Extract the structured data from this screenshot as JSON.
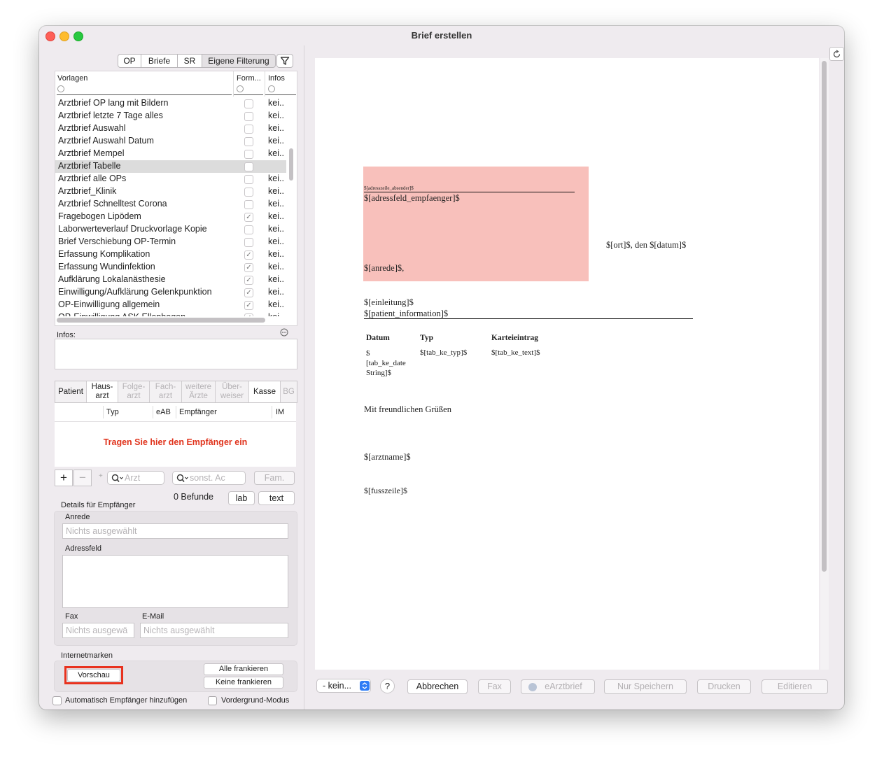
{
  "window": {
    "title": "Brief erstellen"
  },
  "filter_tabs": [
    "OP",
    "Briefe",
    "SR",
    "Eigene Filterung"
  ],
  "list": {
    "headers": {
      "vorlagen": "Vorlagen",
      "form": "Form...",
      "infos": "Infos"
    },
    "rows": [
      {
        "name": "Arztbrief OP lang mit Bildern",
        "checked": false,
        "info": "kei.."
      },
      {
        "name": "Arztbrief letzte 7 Tage alles",
        "checked": false,
        "info": "kei.."
      },
      {
        "name": "Arztbrief Auswahl",
        "checked": false,
        "info": "kei.."
      },
      {
        "name": "Arztbrief Auswahl Datum",
        "checked": false,
        "info": "kei.."
      },
      {
        "name": "Arztbrief Mempel",
        "checked": false,
        "info": "kei.."
      },
      {
        "name": "Arztbrief Tabelle",
        "checked": false,
        "info": "",
        "selected": true
      },
      {
        "name": "Arztbrief alle OPs",
        "checked": false,
        "info": "kei.."
      },
      {
        "name": "Arztbrief_Klinik",
        "checked": false,
        "info": "kei.."
      },
      {
        "name": "Arztbrief Schnelltest Corona",
        "checked": false,
        "info": "kei.."
      },
      {
        "name": "Fragebogen Lipödem",
        "checked": true,
        "info": "kei.."
      },
      {
        "name": "Laborwerteverlauf Druckvorlage Kopie",
        "checked": false,
        "info": "kei.."
      },
      {
        "name": "Brief Verschiebung OP-Termin",
        "checked": false,
        "info": "kei.."
      },
      {
        "name": "Erfassung Komplikation",
        "checked": true,
        "info": "kei.."
      },
      {
        "name": "Erfassung Wundinfektion",
        "checked": true,
        "info": "kei.."
      },
      {
        "name": "Aufklärung Lokalanästhesie",
        "checked": true,
        "info": "kei.."
      },
      {
        "name": "Einwilligung/Aufklärung Gelenkpunktion",
        "checked": true,
        "info": "kei.."
      },
      {
        "name": "OP-Einwilligung allgemein",
        "checked": true,
        "info": "kei.."
      },
      {
        "name": "OP-Einwilligung ASK Ellenbogen",
        "checked": true,
        "info": "kei.."
      }
    ]
  },
  "infos_label": "Infos:",
  "recipient_tabs": [
    "Patient",
    "Haus-\narzt",
    "Folge-\narzt",
    "Fach-\narzt",
    "weitere\nÄrzte",
    "Über-\nweiser",
    "Kasse",
    "BG"
  ],
  "recipient_table": {
    "headers": [
      "Typ",
      "eAB",
      "Empfänger",
      "IM"
    ],
    "empty_hint": "Tragen Sie hier den Empfänger ein"
  },
  "search": {
    "arzt_placeholder": "Arzt",
    "sonst_placeholder": "sonst. Ac",
    "fam_label": "Fam."
  },
  "befunde": {
    "count_label": "0 Befunde",
    "lab": "lab",
    "text": "text"
  },
  "details": {
    "title": "Details für Empfänger",
    "anrede_label": "Anrede",
    "anrede_value": "Nichts ausgewählt",
    "adressfeld_label": "Adressfeld",
    "fax_label": "Fax",
    "fax_value": "Nichts ausgewä",
    "email_label": "E-Mail",
    "email_value": "Nichts ausgewählt"
  },
  "internetmarken": {
    "title": "Internetmarken",
    "vorschau": "Vorschau",
    "alle_frankieren": "Alle frankieren",
    "keine_frankieren": "Keine frankieren"
  },
  "checkboxes": {
    "auto": "Automatisch Empfänger hinzufügen",
    "vordergrund": "Vordergrund-Modus"
  },
  "document": {
    "absender": "$[adresszeile_absender]$",
    "empfaenger": "$[adressfeld_empfaenger]$",
    "anrede": "$[anrede]$,",
    "ort_datum": "$[ort]$, den $[datum]$",
    "einleitung": "$[einleitung]$",
    "patient_information": "$[patient_information]$",
    "table_headers": [
      "Datum",
      "Typ",
      "Karteieintrag"
    ],
    "table_cells": [
      "$\n[tab_ke_date\nString]$",
      "$[tab_ke_typ]$",
      "$[tab_ke_text]$"
    ],
    "gruss": "Mit freundlichen Grüßen",
    "arztname": "$[arztname]$",
    "fusszeile": "$[fusszeile]$"
  },
  "bottom_bar": {
    "dropdown": "- kein...",
    "help": "?",
    "abbrechen": "Abbrechen",
    "fax": "Fax",
    "earztbrief": "eArztbrief",
    "nur_speichern": "Nur Speichern",
    "drucken": "Drucken",
    "editieren": "Editieren"
  },
  "colors": {
    "address_box": "#f8c0bb",
    "hint_red": "#e0331c",
    "vorschau_outline": "#e8321e"
  }
}
